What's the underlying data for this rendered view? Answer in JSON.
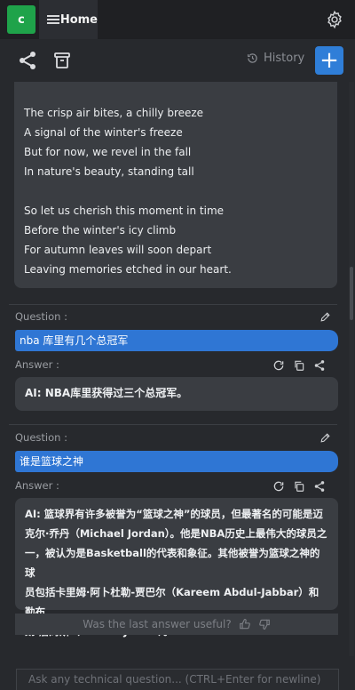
{
  "app": {
    "badge": "c"
  },
  "tab": {
    "label": "Home"
  },
  "toolbar": {
    "history_label": "History",
    "new_label": "+"
  },
  "poem": {
    "lines": [
      "The crisp air bites, a chilly breeze",
      "A signal of the winter's freeze",
      "But for now, we revel in the fall",
      "In nature's beauty, standing tall",
      "So let us cherish this moment in time",
      "Before the winter's icy climb",
      "For autumn leaves will soon depart",
      "Leaving memories etched in our heart."
    ]
  },
  "qa": [
    {
      "question_label": "Question :",
      "question": "nba 库里有几个总冠军",
      "answer_label": "Answer :",
      "answer": "AI: NBA库里获得过三个总冠军。"
    },
    {
      "question_label": "Question :",
      "question": "谁是篮球之神",
      "answer_label": "Answer :",
      "answer_lines": [
        "AI: 篮球界有许多被誉为“篮球之神”的球员，但最著名的可能是迈",
        "克尔·乔丹（Michael Jordan）。他是NBA历史上最伟大的球员之",
        "一，被认为是Basketball的代表和象征。其他被誉为篮球之神的球",
        "员包括卡里姆·阿卜杜勒-贾巴尔（Kareem Abdul-Jabbar）和勒布",
        "朗·詹姆斯（LeBron James）。"
      ]
    }
  ],
  "feedback": {
    "prompt": "Was the last answer useful?"
  },
  "input": {
    "placeholder": "Ask any technical question... (CTRL+Enter for newline)"
  },
  "colors": {
    "accent": "#2f7ed8",
    "badge": "#1fa34a",
    "question_bar": "#2f76d4"
  }
}
